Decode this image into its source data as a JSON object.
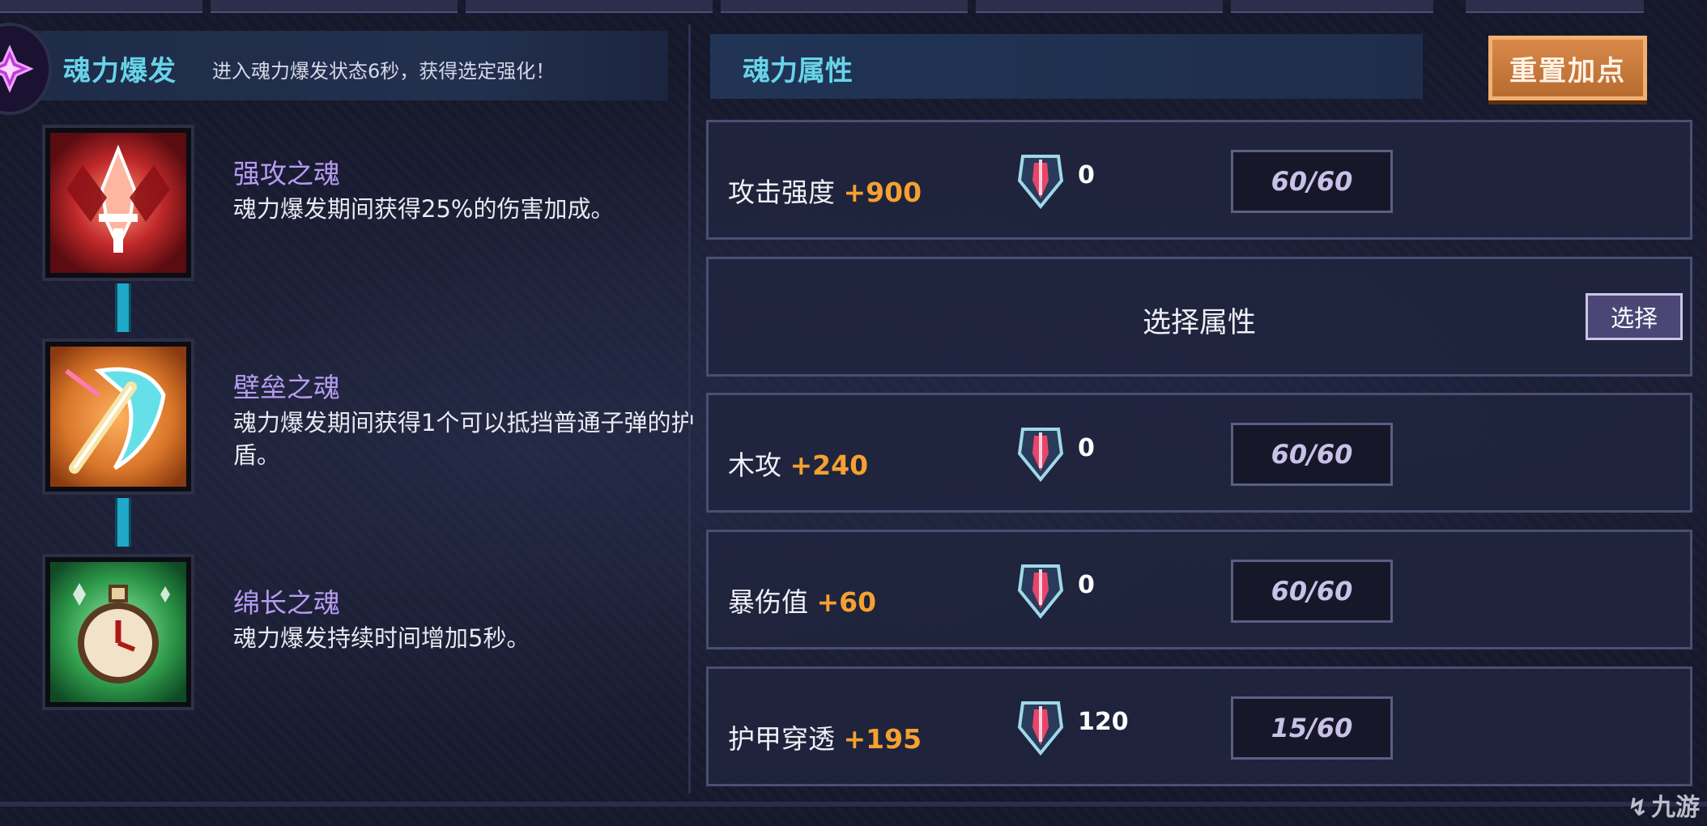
{
  "burst": {
    "title": "魂力爆发",
    "description": "进入魂力爆发状态6秒，获得选定强化！"
  },
  "skills": [
    {
      "name": "强攻之魂",
      "description": "魂力爆发期间获得25%的伤害加成。",
      "icon": "flame-icon"
    },
    {
      "name": "壁垒之魂",
      "description": "魂力爆发期间获得1个可以抵挡普通子弹的护盾。",
      "icon": "shield-icon"
    },
    {
      "name": "绵长之魂",
      "description": "魂力爆发持续时间增加5秒。",
      "icon": "stopwatch-icon"
    }
  ],
  "attributes": {
    "title": "魂力属性",
    "reset_label": "重置加点",
    "rows": [
      {
        "label": "攻击强度",
        "bonus": "+900",
        "gem_count": "0",
        "level": "60/60"
      },
      {
        "select_label": "选择属性",
        "select_button": "选择"
      },
      {
        "label": "木攻",
        "bonus": "+240",
        "gem_count": "0",
        "level": "60/60"
      },
      {
        "label": "暴伤值",
        "bonus": "+60",
        "gem_count": "0",
        "level": "60/60"
      },
      {
        "label": "护甲穿透",
        "bonus": "+195",
        "gem_count": "120",
        "level": "15/60"
      }
    ]
  },
  "watermark": {
    "text": "九游",
    "icon": "jiuyou-logo-icon"
  },
  "colors": {
    "accent_cyan": "#67d3e8",
    "skill_name": "#b79cf2",
    "bonus_orange": "#f5a030",
    "reset_button": "#c97a3c"
  }
}
